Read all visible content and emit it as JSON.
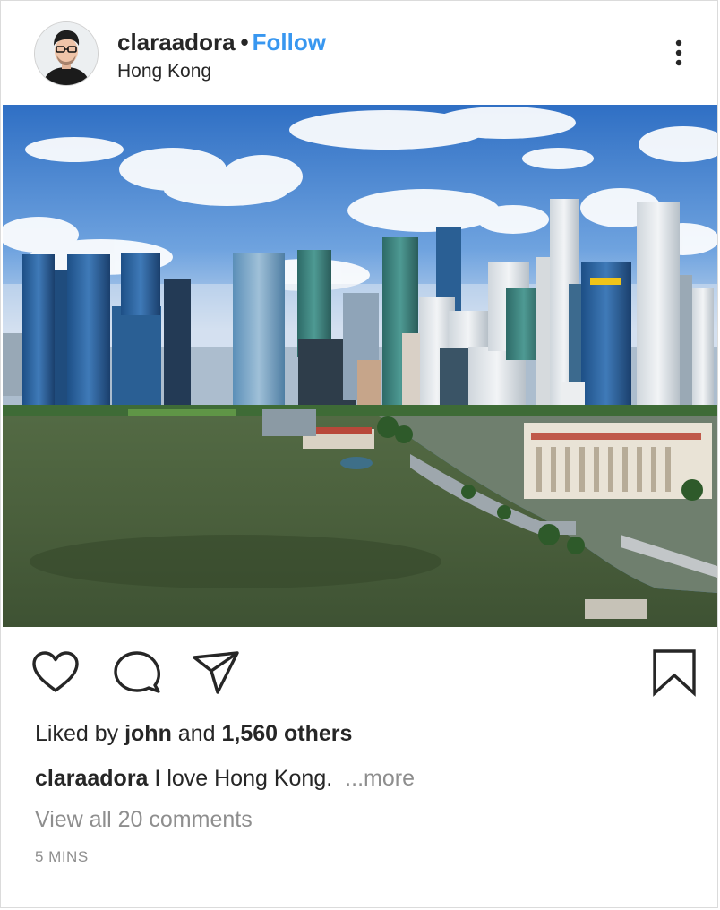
{
  "post": {
    "username": "claraadora",
    "separator": "•",
    "follow_label": "Follow",
    "location": "Hong Kong",
    "likes": {
      "prefix": "Liked by",
      "user": "john",
      "conjunction": "and",
      "count_text": "1,560 others"
    },
    "caption": {
      "username": "claraadora",
      "text": "I love Hong Kong.",
      "more_label": "...more"
    },
    "comments_label": "View all 20 comments",
    "timestamp": "5 MINS"
  },
  "icons": {
    "more": "more-options-icon",
    "like": "heart-icon",
    "comment": "comment-bubble-icon",
    "share": "paper-plane-icon",
    "save": "bookmark-icon"
  },
  "colors": {
    "text": "#262626",
    "link": "#3897f0",
    "muted": "#8e8e8e",
    "border": "#dbdbdb"
  }
}
